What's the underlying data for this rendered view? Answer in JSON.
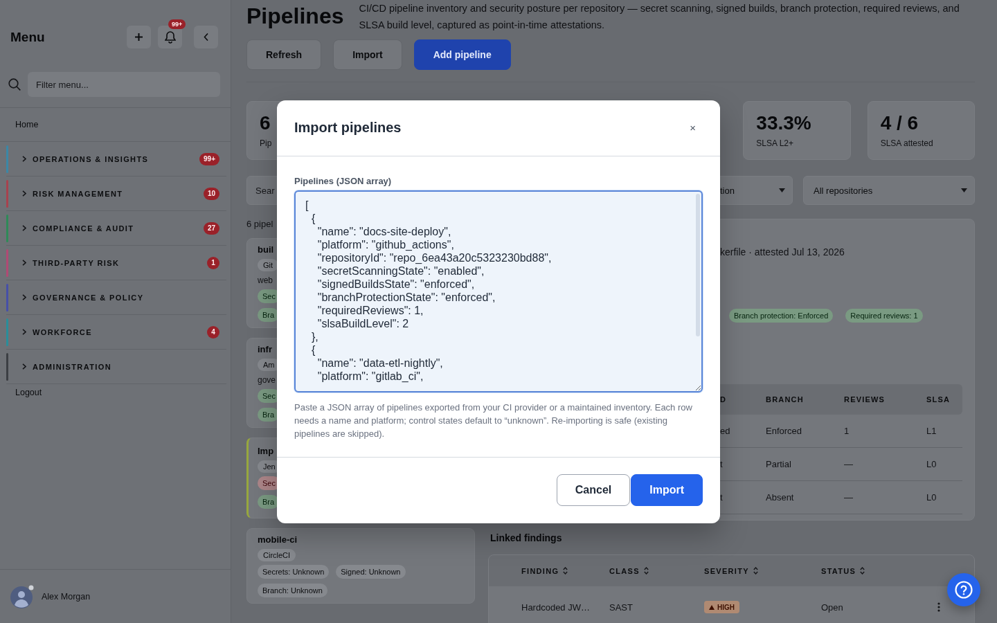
{
  "sidebar": {
    "title": "Menu",
    "notification_badge": "99+",
    "search": {
      "placeholder": "Filter menu..."
    },
    "home": "Home",
    "sections": [
      {
        "label": "OPERATIONS & INSIGHTS",
        "color": "#3b87a6",
        "badge": "99+",
        "expanded": false
      },
      {
        "label": "RISK MANAGEMENT",
        "color": "#a8424e",
        "badge": "10",
        "expanded": false
      },
      {
        "label": "COMPLIANCE & AUDIT",
        "color": "#2f8a58",
        "badge": "27",
        "expanded": false
      },
      {
        "label": "THIRD-PARTY RISK",
        "color": "#b04a74",
        "badge": "1",
        "expanded": false
      },
      {
        "label": "GOVERNANCE & POLICY",
        "color": "#4650a8",
        "expanded": false
      },
      {
        "label": "WORKFORCE",
        "color": "#2a8e9a",
        "badge": "4",
        "expanded": false
      },
      {
        "label": "ADMINISTRATION",
        "color": "#3c3f44",
        "expanded": false
      }
    ],
    "logout": "Logout",
    "user": {
      "name": "Alex Morgan"
    }
  },
  "page": {
    "title": "Pipelines",
    "description": "CI/CD pipeline inventory and security posture per repository — secret scanning, signed builds, branch protection, required reviews, and SLSA build level, captured as point-in-time attestations.",
    "buttons": [
      {
        "label": "Refresh",
        "kind": "secondary"
      },
      {
        "label": "Import",
        "kind": "secondary"
      },
      {
        "label": "Add pipeline",
        "kind": "primary"
      }
    ]
  },
  "stats": [
    {
      "value": "6",
      "label": "Pip"
    },
    {
      "value": "33.3%",
      "label": "SLSA L2+"
    },
    {
      "value": "4 / 6",
      "label": "SLSA attested"
    }
  ],
  "filters": {
    "search": {
      "placeholder": "Sear"
    },
    "selects": [
      {
        "value": "tion"
      },
      {
        "value": "All repositories"
      }
    ]
  },
  "pipelines": {
    "count": "6 pipel",
    "items": [
      {
        "name": "buil",
        "platform": "Git",
        "repo": "web",
        "selected": false,
        "chip_rows": [
          [
            {
              "label": "Sec",
              "kind": "good"
            }
          ],
          [
            {
              "label": "Bra",
              "kind": "good"
            }
          ]
        ]
      },
      {
        "name": "infr",
        "platform": "Am",
        "repo": "gove",
        "selected": false,
        "chip_rows": [
          [
            {
              "label": "Sec",
              "kind": "good"
            }
          ],
          [
            {
              "label": "Bra",
              "kind": "good"
            }
          ]
        ]
      },
      {
        "name": "Imp",
        "platform": "Jen",
        "selected": true,
        "chip_rows": [
          [
            {
              "label": "Sec",
              "kind": "bad"
            }
          ],
          [
            {
              "label": "Bra",
              "kind": "good"
            }
          ]
        ]
      },
      {
        "name": "mobile-ci",
        "platform": "CircleCI",
        "selected": false,
        "chip_rows": [
          [
            {
              "label": "Secrets: Unknown",
              "kind": "unknown"
            },
            {
              "label": "Signed: Unknown",
              "kind": "unknown"
            }
          ],
          [
            {
              "label": "Branch: Unknown",
              "kind": "unknown"
            }
          ]
        ]
      }
    ]
  },
  "detail": {
    "attestation": "kerfile · attested Jul 13, 2026",
    "chips": [
      {
        "label": "Branch protection: Enforced",
        "kind": "good"
      },
      {
        "label": "Required reviews: 1",
        "kind": "good"
      }
    ],
    "controls_table": {
      "columns": [
        "D",
        "BRANCH",
        "REVIEWS",
        "SLSA"
      ],
      "rows": [
        [
          "ed",
          "Enforced",
          "1",
          "L1"
        ],
        [
          "t",
          "Partial",
          "—",
          "L0"
        ],
        [
          "t",
          "Absent",
          "—",
          "L0"
        ]
      ]
    }
  },
  "findings": {
    "title": "Linked findings",
    "columns": [
      "FINDING",
      "CLASS",
      "SEVERITY",
      "STATUS"
    ],
    "rows": [
      {
        "finding": "Hardcoded JW…",
        "class": "SAST",
        "severity": "HIGH",
        "status": "Open"
      }
    ]
  },
  "modal": {
    "title": "Import pipelines",
    "close": "×",
    "field": {
      "label": "Pipelines (JSON array)",
      "value": "[\n  {\n    \"name\": \"docs-site-deploy\",\n    \"platform\": \"github_actions\",\n    \"repositoryId\": \"repo_6ea43a20c5323230bd88\",\n    \"secretScanningState\": \"enabled\",\n    \"signedBuildsState\": \"enforced\",\n    \"branchProtectionState\": \"enforced\",\n    \"requiredReviews\": 1,\n    \"slsaBuildLevel\": 2\n  },\n  {\n    \"name\": \"data-etl-nightly\",\n    \"platform\": \"gitlab_ci\","
    },
    "help": "Paste a JSON array of pipelines exported from your CI provider or a maintained inventory. Each row needs a name and platform; control states default to “unknown”. Re-importing is safe (existing pipelines are skipped).",
    "buttons": [
      {
        "label": "Cancel",
        "kind": "secondary"
      },
      {
        "label": "Import",
        "kind": "primary"
      }
    ]
  }
}
